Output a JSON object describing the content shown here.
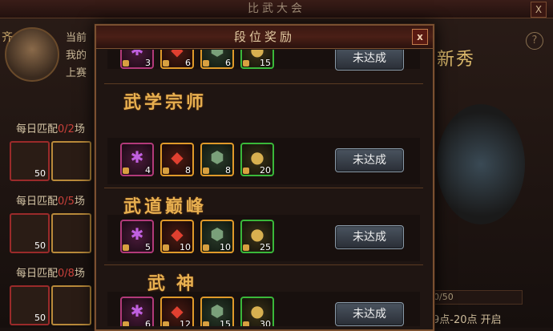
{
  "window": {
    "title": "比武大会",
    "close_label": "X"
  },
  "background": {
    "avatar_tag": "齐",
    "info_lines": [
      "当前",
      "我的",
      "上赛"
    ],
    "daily": [
      {
        "label": "每日匹配",
        "count": "0/2",
        "suffix": "场",
        "slot_values": [
          "50"
        ]
      },
      {
        "label": "每日匹配",
        "count": "0/5",
        "suffix": "场",
        "slot_values": [
          "50"
        ]
      },
      {
        "label": "每日匹配",
        "count": "0/8",
        "suffix": "场",
        "slot_values": [
          "50"
        ]
      }
    ],
    "rank_text": "新秀",
    "help_label": "?",
    "progress_text": "0/50",
    "open_time": "9点-20点 开启"
  },
  "modal": {
    "title": "段位奖励",
    "close_label": "x",
    "top_partial_counts": [
      "3",
      "6",
      "6",
      "15"
    ],
    "top_partial_button": "未达成",
    "tiers": [
      {
        "name": "武学宗师",
        "counts": [
          "4",
          "8",
          "8",
          "20"
        ],
        "button": "未达成"
      },
      {
        "name": "武道巅峰",
        "counts": [
          "5",
          "10",
          "10",
          "25"
        ],
        "button": "未达成"
      },
      {
        "name": "武神",
        "counts": [
          "6",
          "12",
          "15",
          "30"
        ],
        "button": "未达成"
      }
    ]
  },
  "colors": {
    "tier_title": "#e8b050",
    "item_purple": "#b23a7a",
    "item_orange": "#e09a2a",
    "item_green": "#3ab83a"
  },
  "icons": [
    "purple-crystal-icon",
    "red-gem-icon",
    "jade-token-icon",
    "gold-nugget-icon"
  ]
}
